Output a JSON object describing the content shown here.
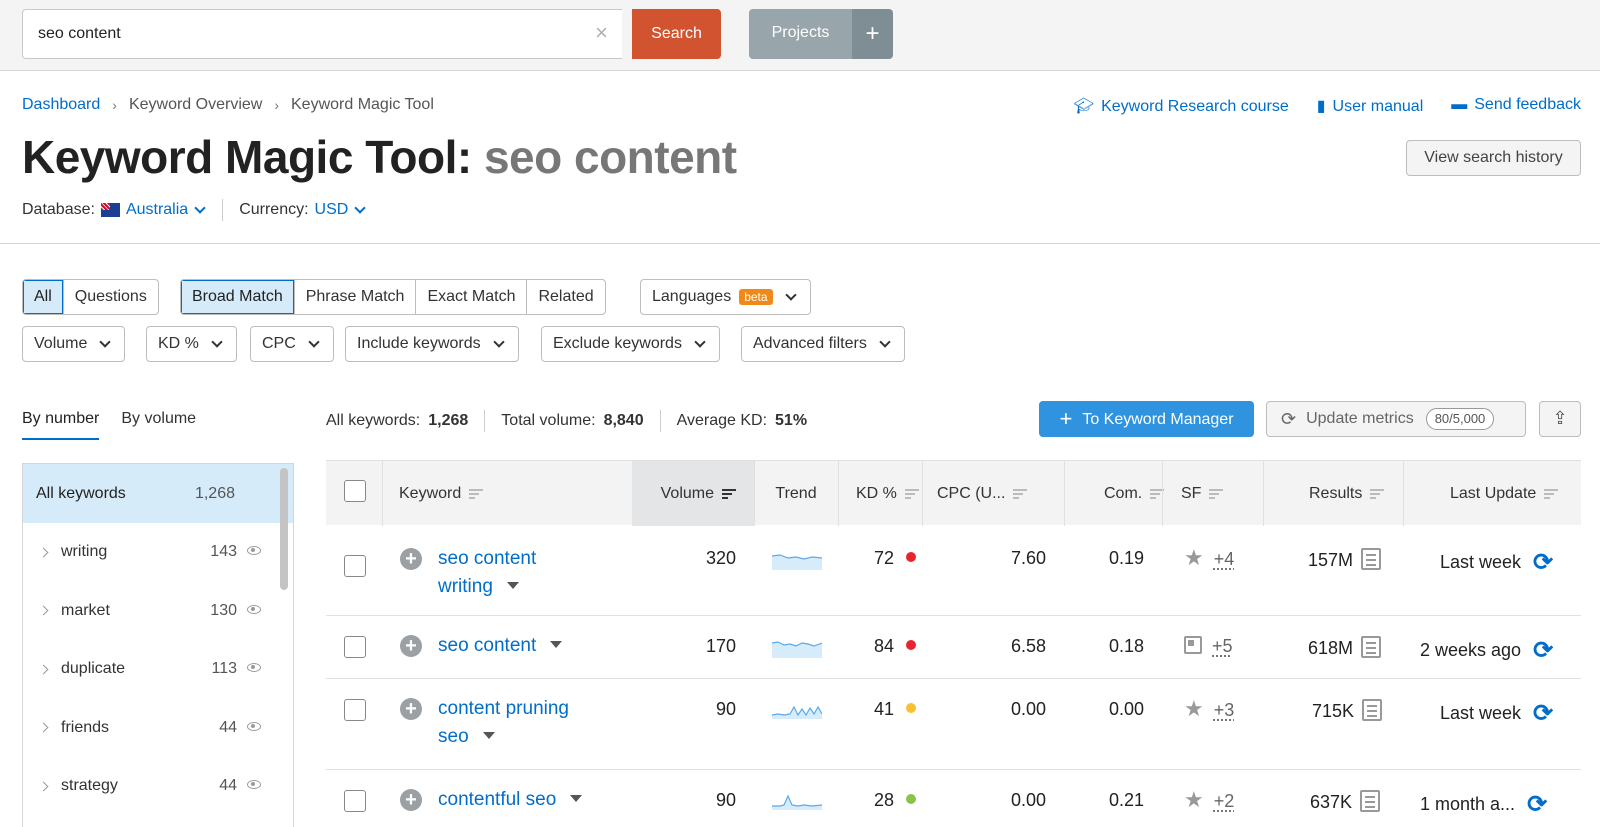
{
  "search": {
    "value": "seo content",
    "clear_icon": "×",
    "button": "Search"
  },
  "projects": {
    "label": "Projects",
    "plus": "+"
  },
  "breadcrumb": [
    "Dashboard",
    "Keyword Overview",
    "Keyword Magic Tool"
  ],
  "top_links": [
    "Keyword Research course",
    "User manual",
    "Send feedback"
  ],
  "title": {
    "prefix": "Keyword Magic Tool:",
    "query": "seo content"
  },
  "history_button": "View search history",
  "database": {
    "label": "Database:",
    "value": "Australia"
  },
  "currency": {
    "label": "Currency:",
    "value": "USD"
  },
  "match_tabs": {
    "all": "All",
    "questions": "Questions",
    "broad": "Broad Match",
    "phrase": "Phrase Match",
    "exact": "Exact Match",
    "related": "Related"
  },
  "languages": {
    "label": "Languages",
    "badge": "beta"
  },
  "filters": [
    "Volume",
    "KD %",
    "CPC",
    "Include keywords",
    "Exclude keywords",
    "Advanced filters"
  ],
  "group_tabs": {
    "by_number": "By number",
    "by_volume": "By volume"
  },
  "groups": {
    "all": {
      "label": "All keywords",
      "count": "1,268"
    },
    "items": [
      {
        "label": "writing",
        "count": "143"
      },
      {
        "label": "market",
        "count": "130"
      },
      {
        "label": "duplicate",
        "count": "113"
      },
      {
        "label": "friends",
        "count": "44"
      },
      {
        "label": "strategy",
        "count": "44"
      }
    ]
  },
  "summary": {
    "all_keywords_label": "All keywords:",
    "all_keywords": "1,268",
    "total_volume_label": "Total volume:",
    "total_volume": "8,840",
    "avg_kd_label": "Average KD:",
    "avg_kd": "51%"
  },
  "actions": {
    "to_manager": "To Keyword Manager",
    "update": "Update metrics",
    "update_quota": "80/5,000"
  },
  "table": {
    "headers": {
      "keyword": "Keyword",
      "volume": "Volume",
      "trend": "Trend",
      "kd": "KD %",
      "cpc": "CPC (U...",
      "com": "Com.",
      "sf": "SF",
      "results": "Results",
      "last_update": "Last Update"
    },
    "rows": [
      {
        "keyword_line1": "seo content",
        "keyword_line2": "writing",
        "volume": "320",
        "kd": "72",
        "kd_color": "#e8242e",
        "cpc": "7.60",
        "com": "0.19",
        "sf_icon": "star-icon",
        "sf_more": "+4",
        "results": "157M",
        "last_update": "Last week"
      },
      {
        "keyword_line1": "seo content",
        "keyword_line2": "",
        "volume": "170",
        "kd": "84",
        "kd_color": "#e8242e",
        "cpc": "6.58",
        "com": "0.18",
        "sf_icon": "news-icon",
        "sf_more": "+5",
        "results": "618M",
        "last_update": "2 weeks ago"
      },
      {
        "keyword_line1": "content pruning",
        "keyword_line2": "seo",
        "volume": "90",
        "kd": "41",
        "kd_color": "#f7c134",
        "cpc": "0.00",
        "com": "0.00",
        "sf_icon": "star-icon",
        "sf_more": "+3",
        "results": "715K",
        "last_update": "Last week"
      },
      {
        "keyword_line1": "contentful seo",
        "keyword_line2": "",
        "volume": "90",
        "kd": "28",
        "kd_color": "#8bc34a",
        "cpc": "0.00",
        "com": "0.21",
        "sf_icon": "star-icon",
        "sf_more": "+2",
        "results": "637K",
        "last_update": "1 month a..."
      }
    ]
  },
  "colors": {
    "accent": "#006dca",
    "search_button": "#d2532f",
    "primary_button": "#2f93e0"
  }
}
